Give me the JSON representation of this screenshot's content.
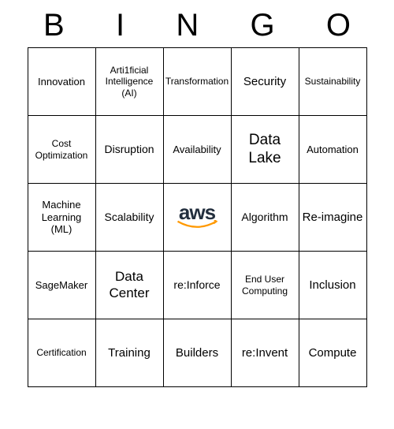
{
  "header": [
    "B",
    "I",
    "N",
    "G",
    "O"
  ],
  "grid": [
    [
      {
        "label": "Innovation",
        "size": "s13"
      },
      {
        "label": "Arti1ficial Intelligence (AI)",
        "size": ""
      },
      {
        "label": "Transformation",
        "size": ""
      },
      {
        "label": "Security",
        "size": "s15"
      },
      {
        "label": "Sustainability",
        "size": ""
      }
    ],
    [
      {
        "label": "Cost Optimization",
        "size": ""
      },
      {
        "label": "Disruption",
        "size": "s14"
      },
      {
        "label": "Availability",
        "size": "s13"
      },
      {
        "label": "Data Lake",
        "size": "s19"
      },
      {
        "label": "Automation",
        "size": "s13"
      }
    ],
    [
      {
        "label": "Machine Learning (ML)",
        "size": "s13"
      },
      {
        "label": "Scalability",
        "size": "s14"
      },
      {
        "label": "aws",
        "size": "",
        "logo": true
      },
      {
        "label": "Algorithm",
        "size": "s14"
      },
      {
        "label": "Re-imagine",
        "size": "s15"
      }
    ],
    [
      {
        "label": "SageMaker",
        "size": "s13"
      },
      {
        "label": "Data Center",
        "size": "s17"
      },
      {
        "label": "re:Inforce",
        "size": "s14"
      },
      {
        "label": "End User Computing",
        "size": ""
      },
      {
        "label": "Inclusion",
        "size": "s15"
      }
    ],
    [
      {
        "label": "Certification",
        "size": ""
      },
      {
        "label": "Training",
        "size": "s15"
      },
      {
        "label": "Builders",
        "size": "s15"
      },
      {
        "label": "re:Invent",
        "size": "s15"
      },
      {
        "label": "Compute",
        "size": "s15"
      }
    ]
  ]
}
